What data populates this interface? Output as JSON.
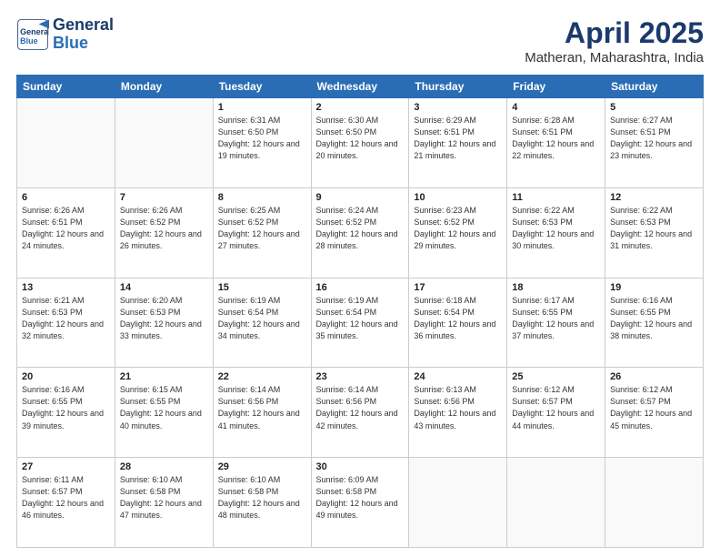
{
  "header": {
    "logo_line1": "General",
    "logo_line2": "Blue",
    "title": "April 2025",
    "subtitle": "Matheran, Maharashtra, India"
  },
  "weekdays": [
    "Sunday",
    "Monday",
    "Tuesday",
    "Wednesday",
    "Thursday",
    "Friday",
    "Saturday"
  ],
  "weeks": [
    [
      {
        "day": "",
        "info": ""
      },
      {
        "day": "",
        "info": ""
      },
      {
        "day": "1",
        "info": "Sunrise: 6:31 AM\nSunset: 6:50 PM\nDaylight: 12 hours and 19 minutes."
      },
      {
        "day": "2",
        "info": "Sunrise: 6:30 AM\nSunset: 6:50 PM\nDaylight: 12 hours and 20 minutes."
      },
      {
        "day": "3",
        "info": "Sunrise: 6:29 AM\nSunset: 6:51 PM\nDaylight: 12 hours and 21 minutes."
      },
      {
        "day": "4",
        "info": "Sunrise: 6:28 AM\nSunset: 6:51 PM\nDaylight: 12 hours and 22 minutes."
      },
      {
        "day": "5",
        "info": "Sunrise: 6:27 AM\nSunset: 6:51 PM\nDaylight: 12 hours and 23 minutes."
      }
    ],
    [
      {
        "day": "6",
        "info": "Sunrise: 6:26 AM\nSunset: 6:51 PM\nDaylight: 12 hours and 24 minutes."
      },
      {
        "day": "7",
        "info": "Sunrise: 6:26 AM\nSunset: 6:52 PM\nDaylight: 12 hours and 26 minutes."
      },
      {
        "day": "8",
        "info": "Sunrise: 6:25 AM\nSunset: 6:52 PM\nDaylight: 12 hours and 27 minutes."
      },
      {
        "day": "9",
        "info": "Sunrise: 6:24 AM\nSunset: 6:52 PM\nDaylight: 12 hours and 28 minutes."
      },
      {
        "day": "10",
        "info": "Sunrise: 6:23 AM\nSunset: 6:52 PM\nDaylight: 12 hours and 29 minutes."
      },
      {
        "day": "11",
        "info": "Sunrise: 6:22 AM\nSunset: 6:53 PM\nDaylight: 12 hours and 30 minutes."
      },
      {
        "day": "12",
        "info": "Sunrise: 6:22 AM\nSunset: 6:53 PM\nDaylight: 12 hours and 31 minutes."
      }
    ],
    [
      {
        "day": "13",
        "info": "Sunrise: 6:21 AM\nSunset: 6:53 PM\nDaylight: 12 hours and 32 minutes."
      },
      {
        "day": "14",
        "info": "Sunrise: 6:20 AM\nSunset: 6:53 PM\nDaylight: 12 hours and 33 minutes."
      },
      {
        "day": "15",
        "info": "Sunrise: 6:19 AM\nSunset: 6:54 PM\nDaylight: 12 hours and 34 minutes."
      },
      {
        "day": "16",
        "info": "Sunrise: 6:19 AM\nSunset: 6:54 PM\nDaylight: 12 hours and 35 minutes."
      },
      {
        "day": "17",
        "info": "Sunrise: 6:18 AM\nSunset: 6:54 PM\nDaylight: 12 hours and 36 minutes."
      },
      {
        "day": "18",
        "info": "Sunrise: 6:17 AM\nSunset: 6:55 PM\nDaylight: 12 hours and 37 minutes."
      },
      {
        "day": "19",
        "info": "Sunrise: 6:16 AM\nSunset: 6:55 PM\nDaylight: 12 hours and 38 minutes."
      }
    ],
    [
      {
        "day": "20",
        "info": "Sunrise: 6:16 AM\nSunset: 6:55 PM\nDaylight: 12 hours and 39 minutes."
      },
      {
        "day": "21",
        "info": "Sunrise: 6:15 AM\nSunset: 6:55 PM\nDaylight: 12 hours and 40 minutes."
      },
      {
        "day": "22",
        "info": "Sunrise: 6:14 AM\nSunset: 6:56 PM\nDaylight: 12 hours and 41 minutes."
      },
      {
        "day": "23",
        "info": "Sunrise: 6:14 AM\nSunset: 6:56 PM\nDaylight: 12 hours and 42 minutes."
      },
      {
        "day": "24",
        "info": "Sunrise: 6:13 AM\nSunset: 6:56 PM\nDaylight: 12 hours and 43 minutes."
      },
      {
        "day": "25",
        "info": "Sunrise: 6:12 AM\nSunset: 6:57 PM\nDaylight: 12 hours and 44 minutes."
      },
      {
        "day": "26",
        "info": "Sunrise: 6:12 AM\nSunset: 6:57 PM\nDaylight: 12 hours and 45 minutes."
      }
    ],
    [
      {
        "day": "27",
        "info": "Sunrise: 6:11 AM\nSunset: 6:57 PM\nDaylight: 12 hours and 46 minutes."
      },
      {
        "day": "28",
        "info": "Sunrise: 6:10 AM\nSunset: 6:58 PM\nDaylight: 12 hours and 47 minutes."
      },
      {
        "day": "29",
        "info": "Sunrise: 6:10 AM\nSunset: 6:58 PM\nDaylight: 12 hours and 48 minutes."
      },
      {
        "day": "30",
        "info": "Sunrise: 6:09 AM\nSunset: 6:58 PM\nDaylight: 12 hours and 49 minutes."
      },
      {
        "day": "",
        "info": ""
      },
      {
        "day": "",
        "info": ""
      },
      {
        "day": "",
        "info": ""
      }
    ]
  ]
}
